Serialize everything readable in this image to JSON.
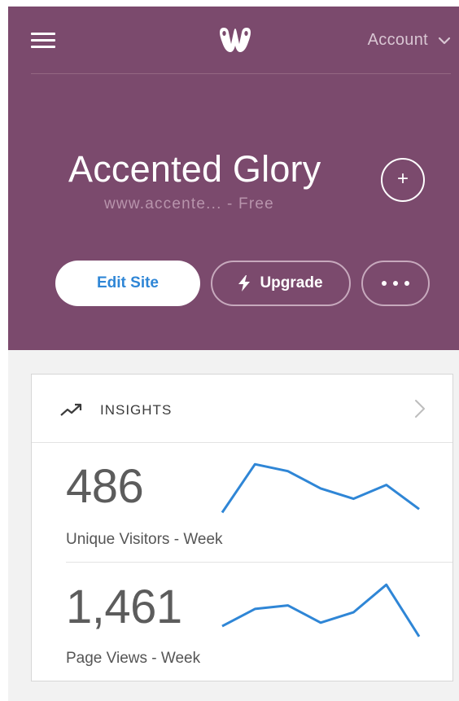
{
  "header": {
    "account_label": "Account"
  },
  "site": {
    "title": "Accented Glory",
    "url_plan": "www.accente... - Free"
  },
  "actions": {
    "edit_label": "Edit Site",
    "upgrade_label": "Upgrade"
  },
  "insights": {
    "title": "INSIGHTS",
    "metrics": [
      {
        "value": "486",
        "label": "Unique Visitors - Week",
        "trend": [
          1,
          8,
          7,
          4.5,
          3,
          5,
          1.5
        ]
      },
      {
        "value": "1,461",
        "label": "Page Views - Week",
        "trend": [
          2,
          4.5,
          5,
          2.5,
          4,
          8,
          0.5
        ]
      }
    ]
  },
  "colors": {
    "brand": "#7b4a6d",
    "accent": "#2f86d6"
  },
  "icons": [
    "menu-icon",
    "weebly-logo-icon",
    "chevron-down-icon",
    "plus-icon",
    "lightning-icon",
    "more-dots-icon",
    "trending-up-icon",
    "chevron-right-icon"
  ]
}
